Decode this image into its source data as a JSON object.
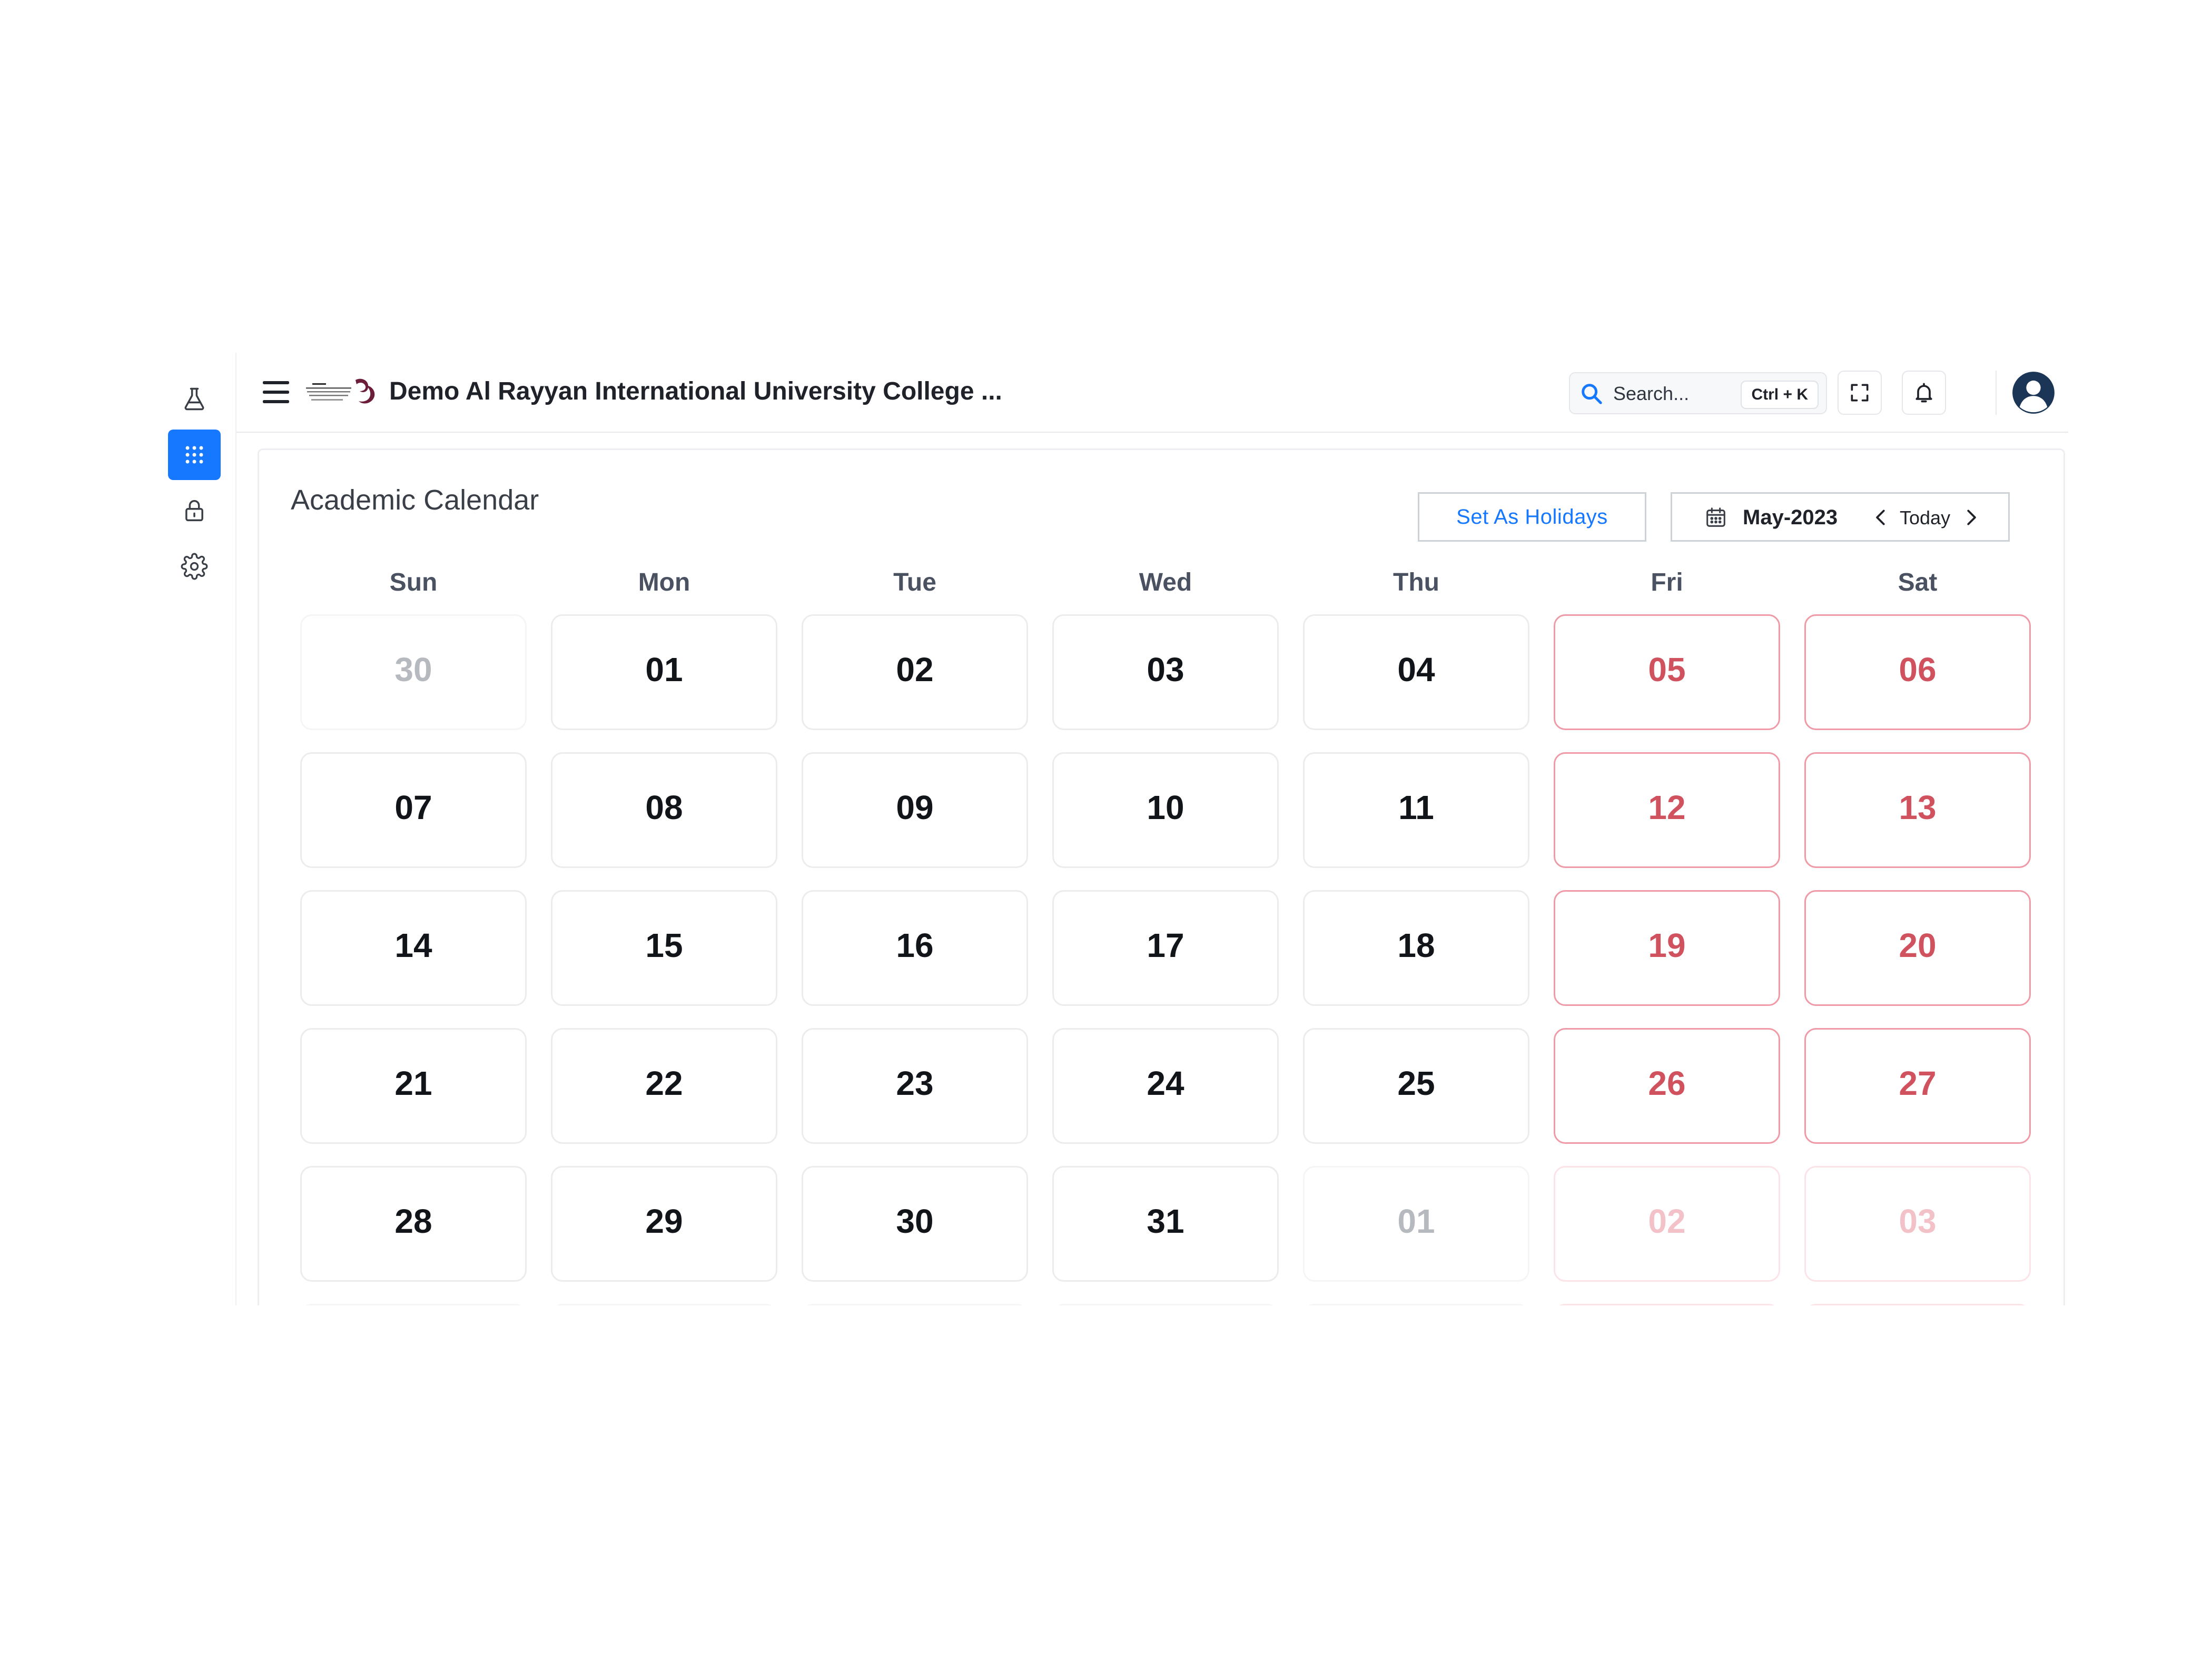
{
  "app": {
    "title": "Demo Al Rayyan International University College ...",
    "logo_name": "al-rayyan-logo"
  },
  "sidebar": {
    "items": [
      {
        "name": "lab",
        "icon": "flask-icon",
        "active": false
      },
      {
        "name": "apps",
        "icon": "apps-grid-icon",
        "active": true
      },
      {
        "name": "security",
        "icon": "lock-icon",
        "active": false
      },
      {
        "name": "settings",
        "icon": "gear-icon",
        "active": false
      }
    ],
    "active_color": "#1677ff"
  },
  "header": {
    "search": {
      "placeholder": "Search...",
      "shortcut": "Ctrl + K",
      "icon": "search-icon"
    },
    "fullscreen_icon": "fullscreen-icon",
    "notification_icon": "bell-icon",
    "avatar_icon": "user-avatar-icon"
  },
  "calendar": {
    "title": "Academic Calendar",
    "set_holidays_label": "Set As Holidays",
    "month_label": "May-2023",
    "today_label": "Today",
    "weekdays": [
      "Sun",
      "Mon",
      "Tue",
      "Wed",
      "Thu",
      "Fri",
      "Sat"
    ],
    "weekend_color": "#d0525e",
    "accent_color": "#1677ff",
    "weeks": [
      [
        {
          "day": "30",
          "outside": true,
          "weekend": false
        },
        {
          "day": "01",
          "outside": false,
          "weekend": false
        },
        {
          "day": "02",
          "outside": false,
          "weekend": false
        },
        {
          "day": "03",
          "outside": false,
          "weekend": false
        },
        {
          "day": "04",
          "outside": false,
          "weekend": false
        },
        {
          "day": "05",
          "outside": false,
          "weekend": true
        },
        {
          "day": "06",
          "outside": false,
          "weekend": true
        }
      ],
      [
        {
          "day": "07",
          "outside": false,
          "weekend": false
        },
        {
          "day": "08",
          "outside": false,
          "weekend": false
        },
        {
          "day": "09",
          "outside": false,
          "weekend": false
        },
        {
          "day": "10",
          "outside": false,
          "weekend": false
        },
        {
          "day": "11",
          "outside": false,
          "weekend": false
        },
        {
          "day": "12",
          "outside": false,
          "weekend": true
        },
        {
          "day": "13",
          "outside": false,
          "weekend": true
        }
      ],
      [
        {
          "day": "14",
          "outside": false,
          "weekend": false
        },
        {
          "day": "15",
          "outside": false,
          "weekend": false
        },
        {
          "day": "16",
          "outside": false,
          "weekend": false
        },
        {
          "day": "17",
          "outside": false,
          "weekend": false
        },
        {
          "day": "18",
          "outside": false,
          "weekend": false
        },
        {
          "day": "19",
          "outside": false,
          "weekend": true
        },
        {
          "day": "20",
          "outside": false,
          "weekend": true
        }
      ],
      [
        {
          "day": "21",
          "outside": false,
          "weekend": false
        },
        {
          "day": "22",
          "outside": false,
          "weekend": false
        },
        {
          "day": "23",
          "outside": false,
          "weekend": false
        },
        {
          "day": "24",
          "outside": false,
          "weekend": false
        },
        {
          "day": "25",
          "outside": false,
          "weekend": false
        },
        {
          "day": "26",
          "outside": false,
          "weekend": true
        },
        {
          "day": "27",
          "outside": false,
          "weekend": true
        }
      ],
      [
        {
          "day": "28",
          "outside": false,
          "weekend": false
        },
        {
          "day": "29",
          "outside": false,
          "weekend": false
        },
        {
          "day": "30",
          "outside": false,
          "weekend": false
        },
        {
          "day": "31",
          "outside": false,
          "weekend": false
        },
        {
          "day": "01",
          "outside": true,
          "weekend": false
        },
        {
          "day": "02",
          "outside": true,
          "weekend": true
        },
        {
          "day": "03",
          "outside": true,
          "weekend": true
        }
      ],
      [
        {
          "day": "",
          "outside": true,
          "weekend": false
        },
        {
          "day": "",
          "outside": true,
          "weekend": false
        },
        {
          "day": "",
          "outside": true,
          "weekend": false
        },
        {
          "day": "",
          "outside": true,
          "weekend": false
        },
        {
          "day": "",
          "outside": true,
          "weekend": false
        },
        {
          "day": "",
          "outside": true,
          "weekend": true
        },
        {
          "day": "",
          "outside": true,
          "weekend": true
        }
      ]
    ]
  }
}
